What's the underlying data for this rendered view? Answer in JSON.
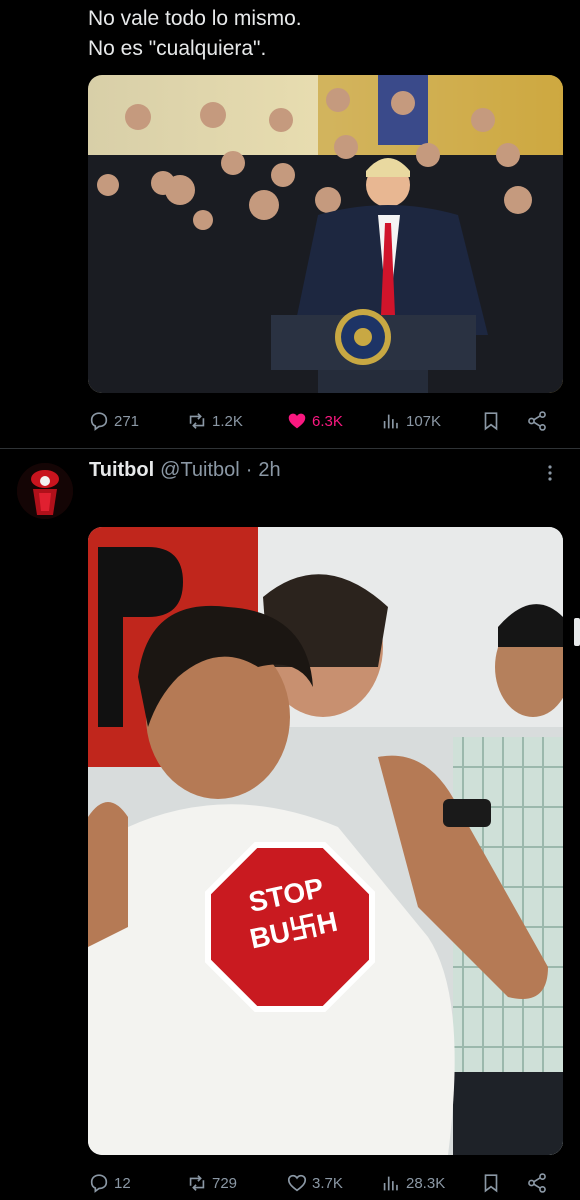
{
  "tweet1": {
    "text_line1": "No vale todo lo mismo.",
    "text_line2": "No es \"cualquiera\".",
    "image_icon": "photo-white-house-event",
    "metrics": {
      "replies": "271",
      "reposts": "1.2K",
      "likes": "6.3K",
      "views": "107K"
    },
    "like_color": "#f91880"
  },
  "tweet2": {
    "display_name": "Tuitbol",
    "handle": "@Tuitbol",
    "separator": "·",
    "time": "2h",
    "avatar_icon": "red-avatar-icon",
    "shirt_text_line1": "STOP",
    "shirt_text_line2": "BU卐H",
    "metrics": {
      "replies": "12",
      "reposts": "729",
      "likes": "3.7K",
      "views": "28.3K"
    }
  },
  "colors": {
    "background": "#000000",
    "text": "#e7e9ea",
    "muted": "#8b98a5",
    "divider": "#2f3336"
  }
}
